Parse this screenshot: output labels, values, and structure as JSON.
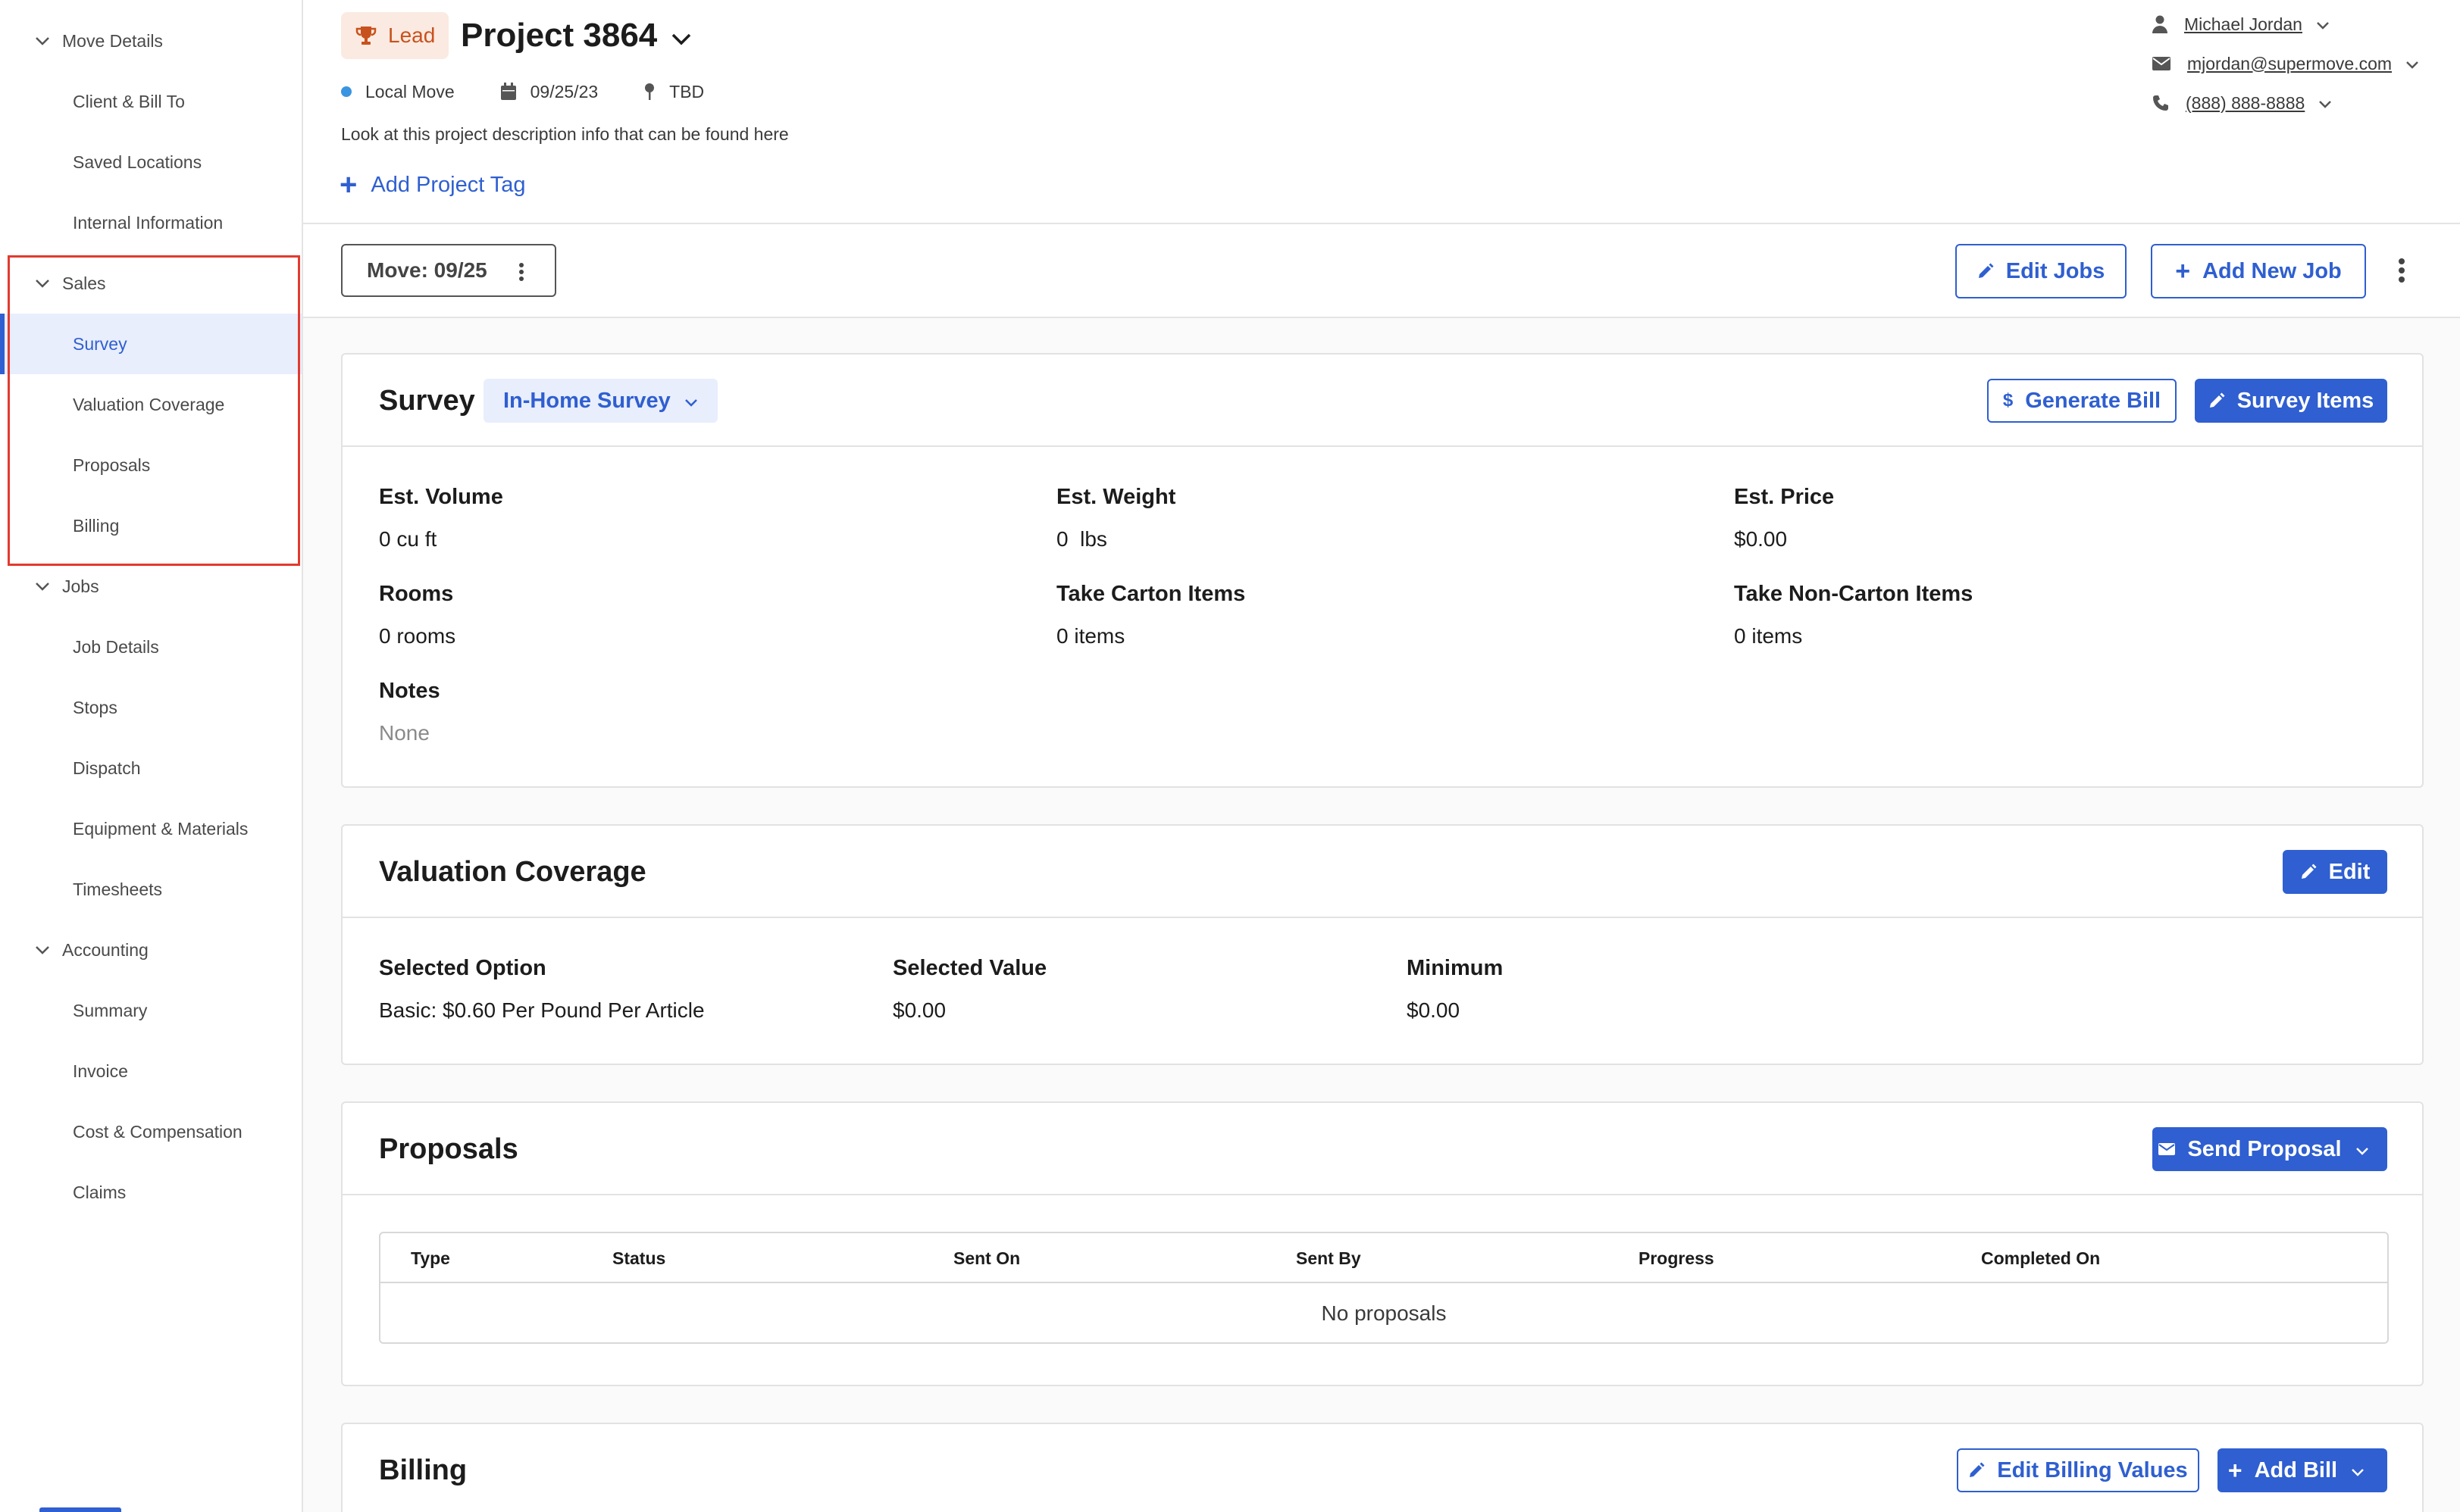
{
  "sidebar": {
    "sections": [
      {
        "label": "Move Details",
        "items": [
          "Client & Bill To",
          "Saved Locations",
          "Internal Information"
        ]
      },
      {
        "label": "Sales",
        "items": [
          "Survey",
          "Valuation Coverage",
          "Proposals",
          "Billing"
        ]
      },
      {
        "label": "Jobs",
        "items": [
          "Job Details",
          "Stops",
          "Dispatch",
          "Equipment & Materials",
          "Timesheets"
        ]
      },
      {
        "label": "Accounting",
        "items": [
          "Summary",
          "Invoice",
          "Cost & Compensation",
          "Claims"
        ]
      }
    ],
    "active_item": "Survey"
  },
  "header": {
    "badge": "Lead",
    "project_title": "Project 3864",
    "move_type": "Local Move",
    "date": "09/25/23",
    "location": "TBD",
    "description": "Look at this project description info that can be found here",
    "add_tag_label": "Add Project Tag",
    "contact": {
      "name": "Michael Jordan",
      "email": "mjordan@supermove.com",
      "phone": "(888) 888-8888"
    }
  },
  "toolbar": {
    "move_selector": "Move: 09/25",
    "edit_jobs": "Edit Jobs",
    "add_new_job": "Add New Job"
  },
  "survey": {
    "title": "Survey",
    "type": "In-Home Survey",
    "generate_bill": "Generate Bill",
    "survey_items": "Survey Items",
    "fields": {
      "est_volume": {
        "label": "Est. Volume",
        "value": "0 cu ft"
      },
      "est_weight": {
        "label": "Est. Weight",
        "value": "0  lbs"
      },
      "est_price": {
        "label": "Est. Price",
        "value": "$0.00"
      },
      "rooms": {
        "label": "Rooms",
        "value": "0 rooms"
      },
      "take_carton": {
        "label": "Take Carton Items",
        "value": "0 items"
      },
      "take_non_carton": {
        "label": "Take Non-Carton Items",
        "value": "0 items"
      },
      "notes": {
        "label": "Notes",
        "value": "None"
      }
    }
  },
  "valuation": {
    "title": "Valuation Coverage",
    "edit": "Edit",
    "selected_option": {
      "label": "Selected Option",
      "value": "Basic: $0.60 Per Pound Per Article"
    },
    "selected_value": {
      "label": "Selected Value",
      "value": "$0.00"
    },
    "minimum": {
      "label": "Minimum",
      "value": "$0.00"
    }
  },
  "proposals": {
    "title": "Proposals",
    "send_proposal": "Send Proposal",
    "columns": [
      "Type",
      "Status",
      "Sent On",
      "Sent By",
      "Progress",
      "Completed On"
    ],
    "empty": "No proposals"
  },
  "billing": {
    "title": "Billing",
    "edit_billing_values": "Edit Billing Values",
    "add_bill": "Add Bill"
  },
  "colors": {
    "accent": "#2f5fd0",
    "lead_badge_bg": "#fbeae1",
    "lead_badge_text": "#c8521d",
    "highlight": "#e23a2f",
    "move_type_dot": "#3a95e0"
  }
}
